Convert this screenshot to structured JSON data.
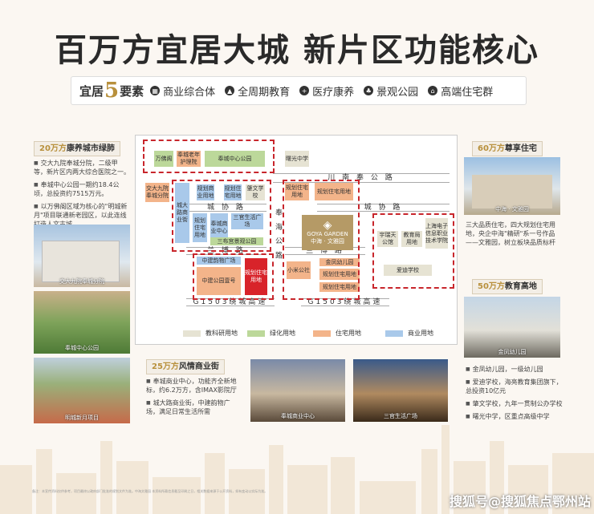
{
  "title": "百万方宜居大城 新片区功能核心",
  "tagbar": {
    "head_left": "宜居",
    "head_num": "5",
    "head_right": "要素",
    "tags": [
      {
        "icon": "building-icon",
        "label": "商业综合体"
      },
      {
        "icon": "graduation-cap-icon",
        "label": "全周期教育"
      },
      {
        "icon": "medical-cross-icon",
        "label": "医疗康养"
      },
      {
        "icon": "park-icon",
        "label": "景观公园"
      },
      {
        "icon": "house-icon",
        "label": "高端住宅群"
      }
    ]
  },
  "left": {
    "header_num": "20万方",
    "header_text": "康养城市绿肺",
    "bullets": [
      "交大九院奉城分院，二级甲等，新片区内两大综合医院之一。",
      "奉城中心公园一期约18.4公顷，总投资约7515万元。",
      "以万佛阁区域为核心的\"明城新月\"项目联通新老园区，以此连线打造人文古城"
    ],
    "photos": [
      "交大九院奉城分院",
      "奉城中心公园",
      "明城新月项目"
    ]
  },
  "right": {
    "header1_num": "60万方",
    "header1_text": "尊享住宅",
    "photo1": "中海 · 文雅园",
    "note1": "三大品质住宅，四大规划住宅用地，央企中海\"精研\"系一号作品——文雅园，树立板块品质标杆",
    "header2_num": "50万方",
    "header2_text": "教育高地",
    "photo2": "金凤幼儿园",
    "bullets2": [
      "金凤幼儿园，一级幼儿园",
      "爱迪学校，海亮教育集团旗下，总投资10亿元",
      "肇文学校，九年一贯制公办学校",
      "曙光中学，区重点高级中学"
    ]
  },
  "bottom": {
    "header_num": "25万方",
    "header_text": "风情商业街",
    "bullets": [
      "奉城商业中心，功能齐全新地标，约6.2万方，含IMAX影院厅",
      "城大路商业街，中建韵物广场，满足日常生活所需"
    ],
    "photos": [
      "奉城商业中心",
      "三官生活广场"
    ]
  },
  "map": {
    "roads": {
      "chuan_nan": "川 南 奉 公 路",
      "chengxie": "城 协 路",
      "chengxie2": "城 协 路",
      "lanbo": "兰 博 路",
      "lanbo2": "兰 博 路",
      "g1503_left": "G1503绕城高速",
      "g1503_right": "G1503绕城高速",
      "fenghai": "奉 海 公 路"
    },
    "blocks": {
      "wanfoge": "万佛阁",
      "fengcheng_lao": "奉城老年护理院",
      "fengcheng_park": "奉城中心公园",
      "shuguang": "曙光中学",
      "jiaoda": "交大九院奉城分院",
      "chengda": "城大路商业街",
      "guihua1": "规划商业用地",
      "guihua2": "规划住宅用地",
      "zhaowen": "肇文学校",
      "guihua3": "规划住宅用地",
      "guihua4": "规划住宅用地",
      "fengcheng_center": "奉城商业中心",
      "sanguan": "三官生活广场",
      "sanbu": "三布宫景观公园",
      "zhongjian": "中建韵物广场",
      "zhongjian_ad": "中建公园壹号",
      "zhonghai": "中海·文雅园",
      "ourpark": "小米公社",
      "jinfeng": "金凤幼儿园",
      "guihua5": "规划住宅用地",
      "yuhua": "规划住宅用地",
      "yuhua2": "宇瑞天公馆",
      "jiaoyu": "教育局用地",
      "shanghai_edu": "上海电子信息职业技术学院",
      "aidi": "爱迪学校",
      "goya_name": "中海 · 文雅园",
      "goya_en": "GOYA GARDEN"
    },
    "legend": [
      "教科研用地",
      "绿化用地",
      "住宅用地",
      "商业用地"
    ]
  },
  "footnote": "备注：本宣传资料仅供参考，项目最终以政府部门批准的规划文件为准。中海文雅园 本资料所载信息截至印刷之日，相关数据来源于公开资料，如有变动以实际为准。",
  "watermark": "搜狐号@搜狐焦点鄂州站"
}
